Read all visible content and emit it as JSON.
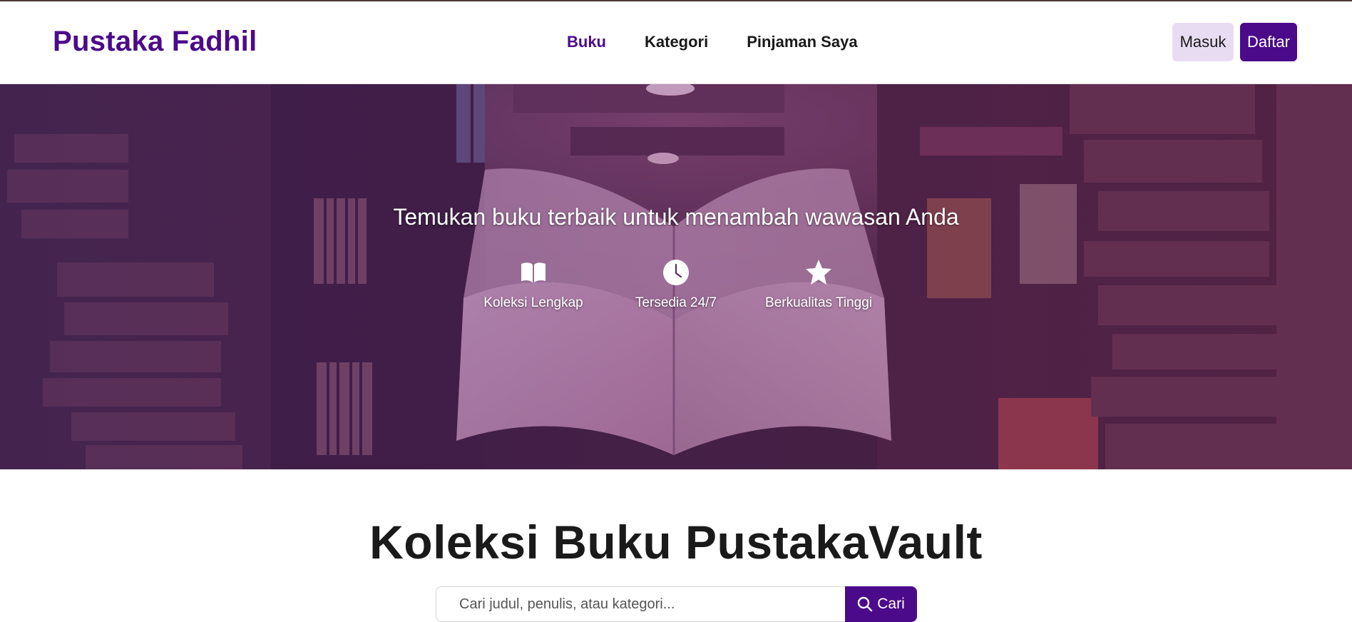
{
  "header": {
    "brand": "Pustaka Fadhil",
    "nav": [
      {
        "label": "Buku",
        "active": true
      },
      {
        "label": "Kategori",
        "active": false
      },
      {
        "label": "Pinjaman Saya",
        "active": false
      }
    ],
    "login_label": "Masuk",
    "register_label": "Daftar"
  },
  "hero": {
    "tagline": "Temukan buku terbaik untuk menambah wawasan Anda",
    "background": "library-books-photo",
    "features": [
      {
        "icon": "book-open-icon",
        "label": "Koleksi Lengkap"
      },
      {
        "icon": "clock-icon",
        "label": "Tersedia 24/7"
      },
      {
        "icon": "star-icon",
        "label": "Berkualitas Tinggi"
      }
    ]
  },
  "collection": {
    "title": "Koleksi Buku PustakaVault",
    "search_placeholder": "Cari judul, penulis, atau kategori...",
    "search_button": "Cari"
  },
  "colors": {
    "brand": "#4b0a8a",
    "login_bg": "#e8dcf2",
    "text": "#1a1a1a"
  }
}
